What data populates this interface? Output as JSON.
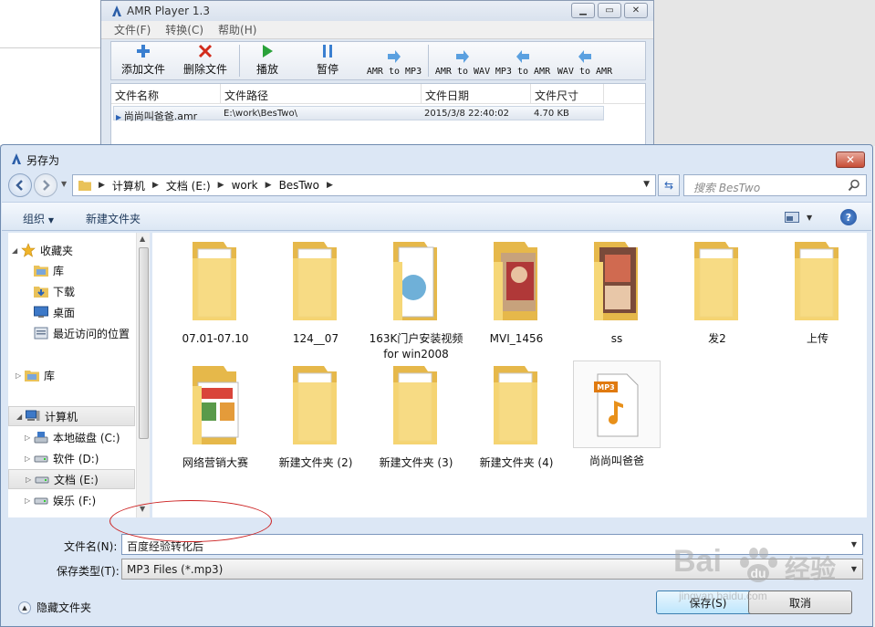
{
  "amr_player": {
    "title": "AMR Player 1.3",
    "menu": [
      "文件(F)",
      "转换(C)",
      "帮助(H)"
    ],
    "toolbar": {
      "add": "添加文件",
      "delete": "删除文件",
      "play": "播放",
      "pause": "暂停",
      "amr_to_mp3": "AMR to MP3",
      "amr_to_wav": "AMR to WAV",
      "mp3_to_amr": "MP3 to AMR",
      "wav_to_amr": "WAV to AMR"
    },
    "list": {
      "columns": [
        "文件名称",
        "文件路径",
        "文件日期",
        "文件尺寸"
      ],
      "rows": [
        {
          "name": "尚尚叫爸爸.amr",
          "path": "E:\\work\\BesTwo\\",
          "date": "2015/3/8 22:40:02",
          "size": "4.70 KB"
        }
      ]
    }
  },
  "dialog": {
    "title": "另存为",
    "breadcrumb": [
      "计算机",
      "文档 (E:)",
      "work",
      "BesTwo"
    ],
    "search_placeholder": "搜索 BesTwo",
    "command_bar": {
      "organize": "组织",
      "new_folder": "新建文件夹"
    },
    "nav": {
      "favorites": "收藏夹",
      "items_fav": [
        "库",
        "下载",
        "桌面",
        "最近访问的位置"
      ],
      "library": "库",
      "computer": "计算机",
      "drives": [
        "本地磁盘 (C:)",
        "软件 (D:)",
        "文档 (E:)",
        "娱乐 (F:)"
      ]
    },
    "files": [
      {
        "name": "07.01-07.10",
        "kind": "folder"
      },
      {
        "name": "124__07",
        "kind": "folder"
      },
      {
        "name": "163K门户安装视频 for win2008",
        "kind": "folder-docs"
      },
      {
        "name": "MVI_1456",
        "kind": "folder-photo"
      },
      {
        "name": "ss",
        "kind": "folder-photo2"
      },
      {
        "name": "发2",
        "kind": "folder"
      },
      {
        "name": "上传",
        "kind": "folder"
      },
      {
        "name": "网络营销大赛",
        "kind": "folder-ppt"
      },
      {
        "name": "新建文件夹 (2)",
        "kind": "folder"
      },
      {
        "name": "新建文件夹 (3)",
        "kind": "folder"
      },
      {
        "name": "新建文件夹 (4)",
        "kind": "folder"
      },
      {
        "name": "尚尚叫爸爸",
        "kind": "mp3"
      }
    ],
    "filename_label": "文件名(N):",
    "filename_value": "百度经验转化后",
    "filetype_label": "保存类型(T):",
    "filetype_value": "MP3 Files (*.mp3)",
    "hide_folders": "隐藏文件夹",
    "save_button": "保存(S)",
    "cancel_button": "取消"
  },
  "watermark": {
    "brand": "Bai",
    "brand2": "经验",
    "sub": "jingyan.baidu.com"
  },
  "colors": {
    "accent": "#2a62b6",
    "folder": "#f2cf6a",
    "annotation": "#cc2020"
  }
}
